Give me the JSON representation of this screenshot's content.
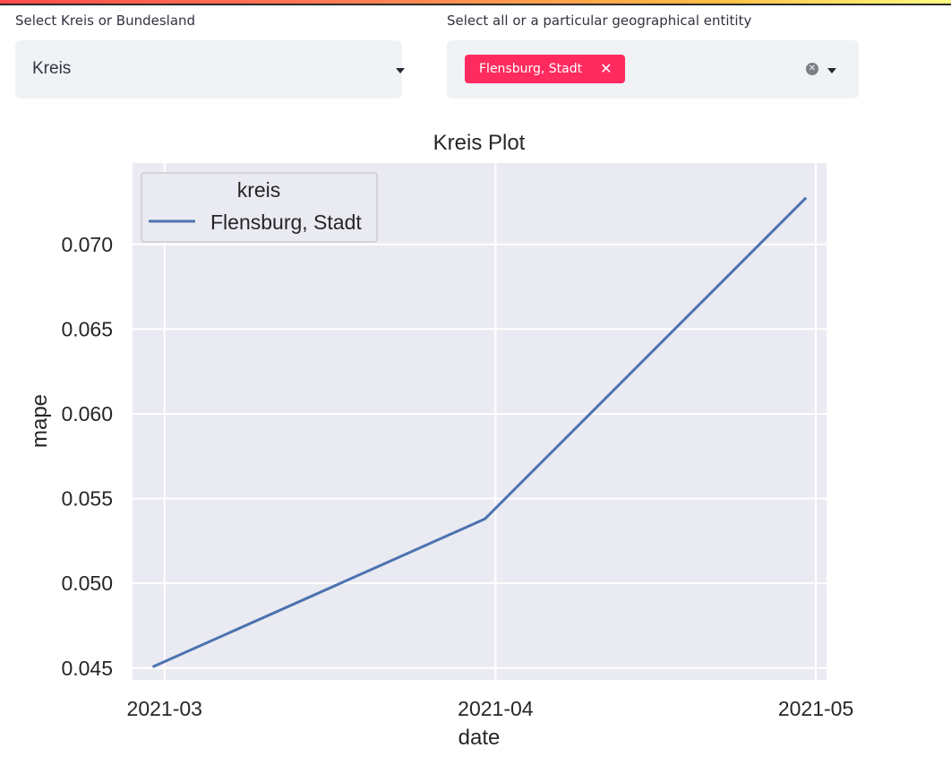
{
  "level_select": {
    "label": "Select Kreis or Bundesland",
    "value": "Kreis"
  },
  "entity_select": {
    "label": "Select all or a particular geographical entitity",
    "selected_tags": [
      "Flensburg, Stadt"
    ],
    "tag_remove_glyph": "✕",
    "clear_glyph": "✕"
  },
  "colors": {
    "accent": "#ff2b5e",
    "plot_background": "#eaeaf2",
    "line": "#4c72b0"
  },
  "chart_data": {
    "type": "line",
    "title": "Kreis Plot",
    "xlabel": "date",
    "ylabel": "mape",
    "x_ticks": [
      "2021-03",
      "2021-04",
      "2021-05"
    ],
    "y_ticks": [
      "0.045",
      "0.050",
      "0.055",
      "0.060",
      "0.065",
      "0.070"
    ],
    "ylim": [
      0.0443,
      0.0748
    ],
    "xlim": [
      "2021-02-26",
      "2021-05-02"
    ],
    "grid": true,
    "legend": {
      "title": "kreis",
      "placement": "top-left"
    },
    "series": [
      {
        "name": "Flensburg, Stadt",
        "x": [
          "2021-02-28",
          "2021-03-31",
          "2021-04-30"
        ],
        "y": [
          0.0451,
          0.0538,
          0.0727
        ]
      }
    ]
  }
}
